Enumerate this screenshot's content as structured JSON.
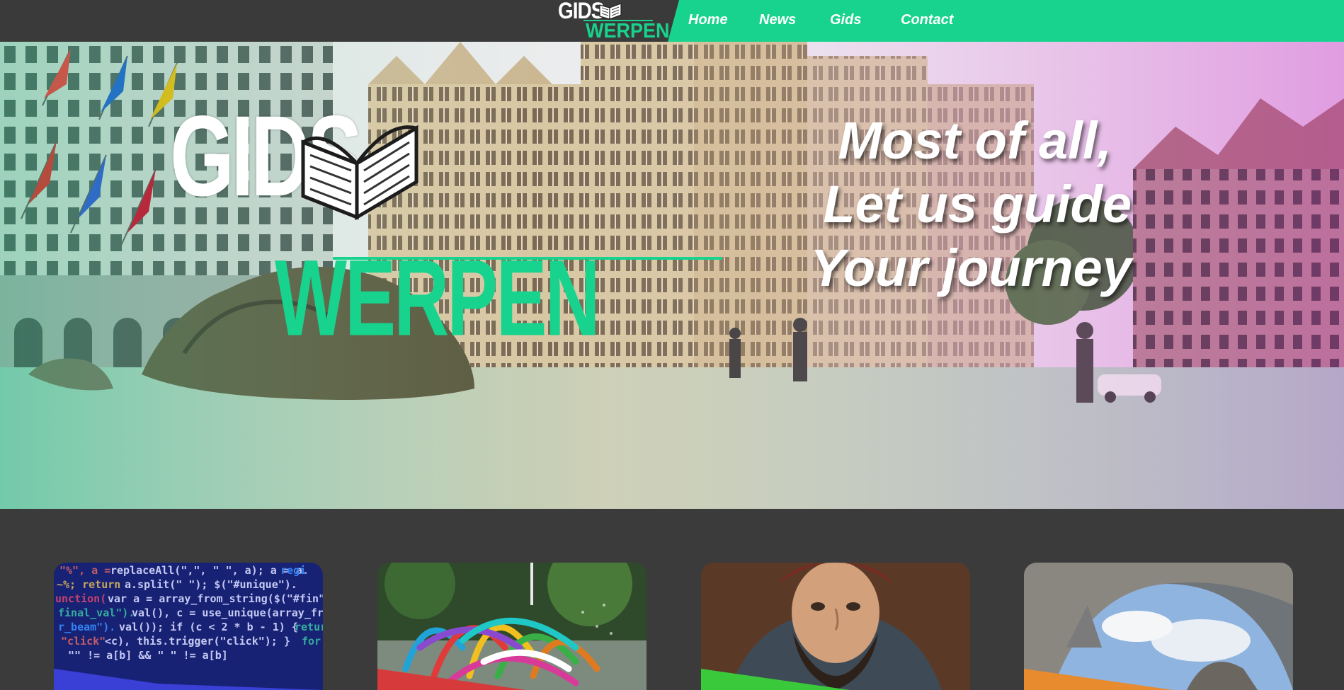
{
  "nav": {
    "logo": {
      "line1": "GIDS",
      "line2": "WERPEN",
      "icon": "open-book-icon"
    },
    "links": [
      "Home",
      "News",
      "Gids",
      "Contact"
    ],
    "colors": {
      "accent": "#17d38e",
      "bar": "#3a3a3a"
    }
  },
  "hero": {
    "logo": {
      "line1": "GIDS",
      "line2": "WERPEN",
      "icon": "open-book-icon"
    },
    "tagline": [
      "Most of all,",
      "Let us guide",
      "Your journey"
    ]
  },
  "cards": [
    {
      "name": "code",
      "accent": "#3a3fd6"
    },
    {
      "name": "fountain",
      "accent": "#d63a3a"
    },
    {
      "name": "portrait",
      "accent": "#3ac93a"
    },
    {
      "name": "arch",
      "accent": "#e88a2e"
    }
  ]
}
